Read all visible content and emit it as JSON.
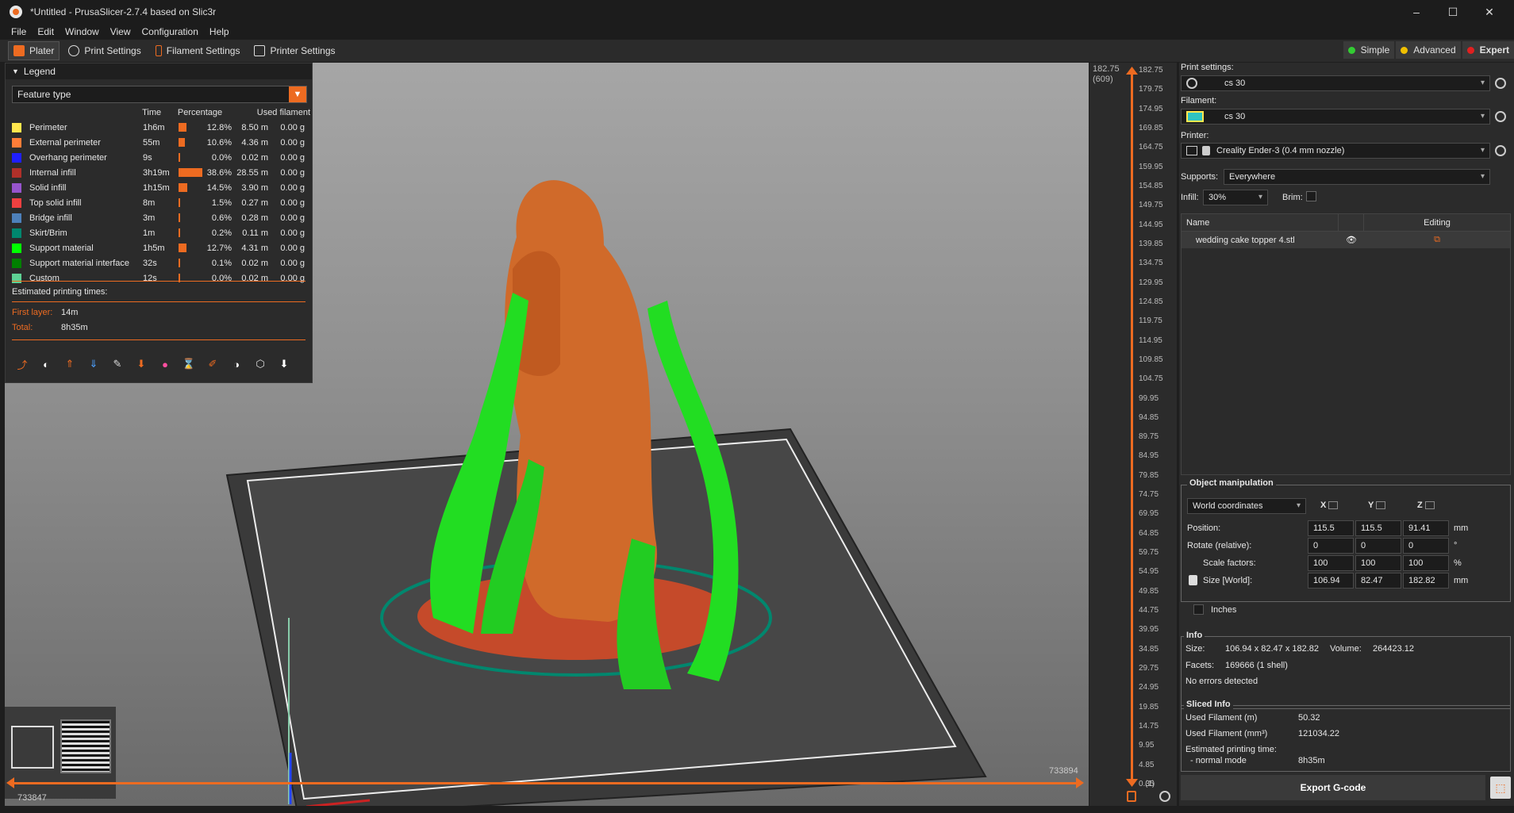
{
  "window": {
    "title": "*Untitled - PrusaSlicer-2.7.4 based on Slic3r",
    "controls": [
      "–",
      "☐",
      "✕"
    ]
  },
  "menu": [
    "File",
    "Edit",
    "Window",
    "View",
    "Configuration",
    "Help"
  ],
  "tabs": [
    {
      "label": "Plater",
      "active": true
    },
    {
      "label": "Print Settings",
      "active": false
    },
    {
      "label": "Filament Settings",
      "active": false
    },
    {
      "label": "Printer Settings",
      "active": false
    }
  ],
  "modes": [
    {
      "label": "Simple",
      "color": "#33cc33",
      "active": false
    },
    {
      "label": "Advanced",
      "color": "#f0c000",
      "active": false
    },
    {
      "label": "Expert",
      "color": "#e02020",
      "active": true
    }
  ],
  "legend": {
    "header": "Legend",
    "view_type": "Feature type",
    "columns": {
      "time": "Time",
      "percentage": "Percentage",
      "used_filament": "Used filament"
    },
    "rows": [
      {
        "name": "Perimeter",
        "color": "#ffe64d",
        "time": "1h6m",
        "pct_value": 12.8,
        "pct": "12.8%",
        "len": "8.50 m",
        "g": "0.00 g"
      },
      {
        "name": "External perimeter",
        "color": "#ff7d38",
        "time": "55m",
        "pct_value": 10.6,
        "pct": "10.6%",
        "len": "4.36 m",
        "g": "0.00 g"
      },
      {
        "name": "Overhang perimeter",
        "color": "#1f1fff",
        "time": "9s",
        "pct_value": 0.0,
        "pct": "0.0%",
        "len": "0.02 m",
        "g": "0.00 g"
      },
      {
        "name": "Internal infill",
        "color": "#b03029",
        "time": "3h19m",
        "pct_value": 38.6,
        "pct": "38.6%",
        "len": "28.55 m",
        "g": "0.00 g"
      },
      {
        "name": "Solid infill",
        "color": "#9654cc",
        "time": "1h15m",
        "pct_value": 14.5,
        "pct": "14.5%",
        "len": "3.90 m",
        "g": "0.00 g"
      },
      {
        "name": "Top solid infill",
        "color": "#f04040",
        "time": "8m",
        "pct_value": 1.5,
        "pct": "1.5%",
        "len": "0.27 m",
        "g": "0.00 g"
      },
      {
        "name": "Bridge infill",
        "color": "#4d80ba",
        "time": "3m",
        "pct_value": 0.6,
        "pct": "0.6%",
        "len": "0.28 m",
        "g": "0.00 g"
      },
      {
        "name": "Skirt/Brim",
        "color": "#00876e",
        "time": "1m",
        "pct_value": 0.2,
        "pct": "0.2%",
        "len": "0.11 m",
        "g": "0.00 g"
      },
      {
        "name": "Support material",
        "color": "#00ff00",
        "time": "1h5m",
        "pct_value": 12.7,
        "pct": "12.7%",
        "len": "4.31 m",
        "g": "0.00 g"
      },
      {
        "name": "Support material interface",
        "color": "#008000",
        "time": "32s",
        "pct_value": 0.1,
        "pct": "0.1%",
        "len": "0.02 m",
        "g": "0.00 g"
      },
      {
        "name": "Custom",
        "color": "#5ed194",
        "time": "12s",
        "pct_value": 0.0,
        "pct": "0.0%",
        "len": "0.02 m",
        "g": "0.00 g"
      }
    ],
    "estimated_label": "Estimated printing times:",
    "first_layer_label": "First layer:",
    "first_layer": "14m",
    "total_label": "Total:",
    "total": "8h35m"
  },
  "sliders": {
    "horizontal_left": "733847",
    "horizontal_right": "733894",
    "vertical_top": "182.75",
    "vertical_top_sub": "(609)",
    "vertical_bottom": "0.35",
    "vertical_bottom_sub": "(1)"
  },
  "ruler_ticks": [
    "182.75",
    "179.75",
    "174.95",
    "169.85",
    "164.75",
    "159.95",
    "154.85",
    "149.75",
    "144.95",
    "139.85",
    "134.75",
    "129.95",
    "124.85",
    "119.75",
    "114.95",
    "109.85",
    "104.75",
    "99.95",
    "94.85",
    "89.75",
    "84.95",
    "79.85",
    "74.75",
    "69.95",
    "64.85",
    "59.75",
    "54.95",
    "49.85",
    "44.75",
    "39.95",
    "34.85",
    "29.75",
    "24.95",
    "19.85",
    "14.75",
    "9.95",
    "4.85",
    "0.35"
  ],
  "sidebar": {
    "print_settings_label": "Print settings:",
    "print_settings_value": "cs 30",
    "filament_label": "Filament:",
    "filament_value": "cs 30",
    "filament_color": "#2fc3c0",
    "printer_label": "Printer:",
    "printer_value": "Creality Ender-3 (0.4 mm nozzle)",
    "supports_label": "Supports:",
    "supports_value": "Everywhere",
    "infill_label": "Infill:",
    "infill_value": "30%",
    "brim_label": "Brim:",
    "list_name_header": "Name",
    "list_editing_header": "Editing",
    "object_name": "wedding cake topper 4.stl"
  },
  "object_manipulation": {
    "title": "Object manipulation",
    "coords": "World coordinates",
    "axes": [
      "X",
      "Y",
      "Z"
    ],
    "rows": [
      {
        "label": "Position:",
        "values": [
          "115.5",
          "115.5",
          "91.41"
        ],
        "unit": "mm"
      },
      {
        "label": "Rotate (relative):",
        "values": [
          "0",
          "0",
          "0"
        ],
        "unit": "°"
      },
      {
        "label": "Scale factors:",
        "values": [
          "100",
          "100",
          "100"
        ],
        "unit": "%"
      },
      {
        "label": "Size [World]:",
        "values": [
          "106.94",
          "82.47",
          "182.82"
        ],
        "unit": "mm"
      }
    ],
    "inches_label": "Inches"
  },
  "info": {
    "title": "Info",
    "size_label": "Size:",
    "size_value": "106.94 x 82.47 x 182.82",
    "volume_label": "Volume:",
    "volume_value": "264423.12",
    "facets_label": "Facets:",
    "facets_value": "169666 (1 shell)",
    "errors": "No errors detected"
  },
  "sliced_info": {
    "title": "Sliced Info",
    "used_m_label": "Used Filament (m)",
    "used_m_value": "50.32",
    "used_mm3_label": "Used Filament (mm³)",
    "used_mm3_value": "121034.22",
    "est_label": "Estimated printing time:",
    "mode_label": "- normal mode",
    "mode_value": "8h35m"
  },
  "export_label": "Export G-code"
}
